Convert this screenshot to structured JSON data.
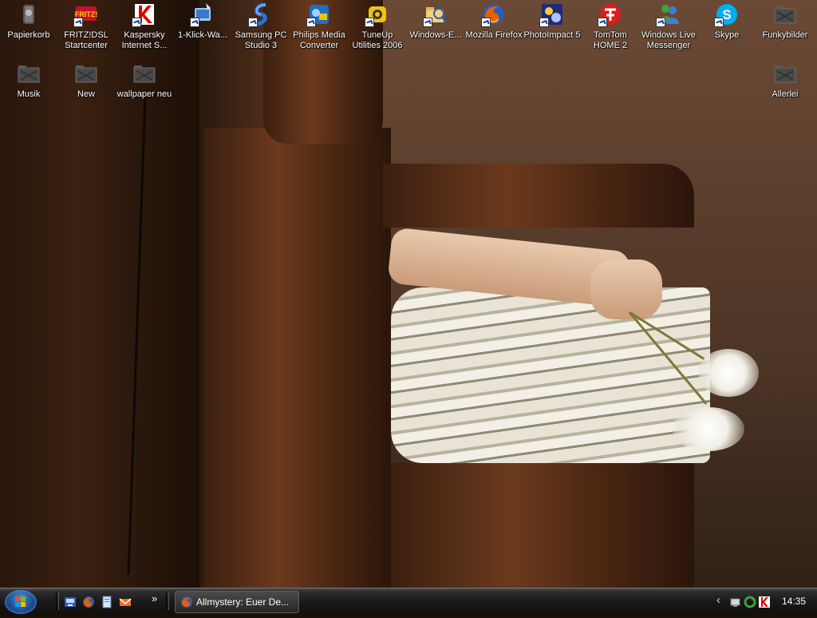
{
  "desktop": {
    "icons": [
      {
        "label": "Papierkorb",
        "icon": "recycle-bin-icon"
      },
      {
        "label": "FRITZ!DSL Startcenter",
        "icon": "fritz-dsl-icon"
      },
      {
        "label": "Kaspersky Internet S...",
        "icon": "kaspersky-icon"
      },
      {
        "label": "1-Klick-Wa...",
        "icon": "pc-maintenance-icon"
      },
      {
        "label": "Samsung PC Studio 3",
        "icon": "samsung-pc-studio-icon"
      },
      {
        "label": "Philips Media Converter",
        "icon": "philips-media-converter-icon"
      },
      {
        "label": "TuneUp Utilities 2006",
        "icon": "tuneup-utilities-icon"
      },
      {
        "label": "Windows-E...",
        "icon": "windows-explorer-icon"
      },
      {
        "label": "Mozilla Firefox",
        "icon": "firefox-icon"
      },
      {
        "label": "PhotoImpact 5",
        "icon": "photoimpact-icon"
      },
      {
        "label": "TomTom HOME 2",
        "icon": "tomtom-icon"
      },
      {
        "label": "Windows Live Messenger",
        "icon": "windows-live-messenger-icon"
      },
      {
        "label": "Skype",
        "icon": "skype-icon"
      },
      {
        "label": "Funkybilder",
        "icon": "folder-icon"
      },
      {
        "label": "Musik",
        "icon": "folder-icon"
      },
      {
        "label": "New",
        "icon": "folder-icon"
      },
      {
        "label": "wallpaper neu",
        "icon": "folder-icon"
      },
      {
        "label": "Allerlei",
        "icon": "folder-icon"
      }
    ]
  },
  "taskbar": {
    "start_icon": "windows-start-orb-icon",
    "quick_launch": [
      "show-desktop-icon",
      "firefox-icon",
      "windows-media-icon",
      "outlook-express-icon"
    ],
    "quick_launch_more": "»",
    "task_button_label": "Allmystery: Euer De...",
    "tray_expand": "‹",
    "clock": "14:35"
  }
}
